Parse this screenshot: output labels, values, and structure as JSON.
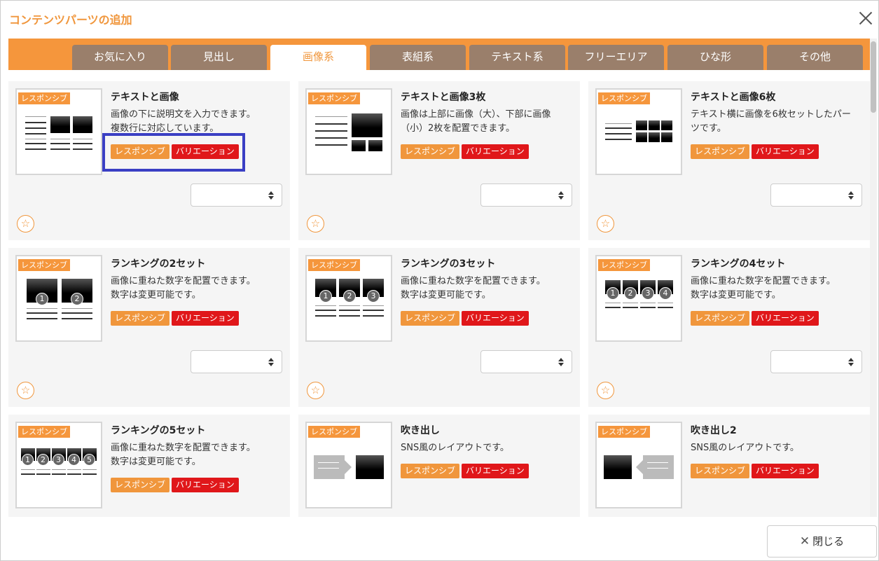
{
  "dialog": {
    "title": "コンテンツパーツの追加",
    "close_icon": "close-icon",
    "close_button_label": "閉じる"
  },
  "tabs": [
    {
      "label": "お気に入り",
      "active": false
    },
    {
      "label": "見出し",
      "active": false
    },
    {
      "label": "画像系",
      "active": true
    },
    {
      "label": "表組系",
      "active": false
    },
    {
      "label": "テキスト系",
      "active": false
    },
    {
      "label": "フリーエリア",
      "active": false
    },
    {
      "label": "ひな形",
      "active": false
    },
    {
      "label": "その他",
      "active": false
    }
  ],
  "badges": {
    "responsive": "レスポンシブ",
    "variation": "バリエーション",
    "thumb_tag": "レスポンシブ"
  },
  "colors": {
    "accent": "#f5963c",
    "tab_inactive": "#9a7f6b",
    "variation_red": "#e0171a",
    "highlight_blue": "#3a3fc4"
  },
  "cards": [
    {
      "title": "テキストと画像",
      "desc": [
        "画像の下に説明文を入力できます。",
        "複数行に対応しています。"
      ]
    },
    {
      "title": "テキストと画像3枚",
      "desc": [
        "画像は上部に画像（大）、下部に画像",
        "（小）2枚を配置できます。"
      ]
    },
    {
      "title": "テキストと画像6枚",
      "desc": [
        "テキスト横に画像を6枚セットしたパー",
        "ツです。"
      ]
    },
    {
      "title": "ランキングの2セット",
      "desc": [
        "画像に重ねた数字を配置できます。",
        "数字は変更可能です。"
      ]
    },
    {
      "title": "ランキングの3セット",
      "desc": [
        "画像に重ねた数字を配置できます。",
        "数字は変更可能です。"
      ]
    },
    {
      "title": "ランキングの4セット",
      "desc": [
        "画像に重ねた数字を配置できます。",
        "数字は変更可能です。"
      ]
    },
    {
      "title": "ランキングの5セット",
      "desc": [
        "画像に重ねた数字を配置できます。",
        "数字は変更可能です。"
      ]
    },
    {
      "title": "吹き出し",
      "desc": [
        "SNS風のレイアウトです。"
      ]
    },
    {
      "title": "吹き出し2",
      "desc": [
        "SNS風のレイアウトです。"
      ]
    }
  ],
  "ranking_numbers": [
    "1",
    "2",
    "3",
    "4",
    "5"
  ],
  "favorite_icon": "star-icon",
  "select_icon": "updown-arrows-icon"
}
